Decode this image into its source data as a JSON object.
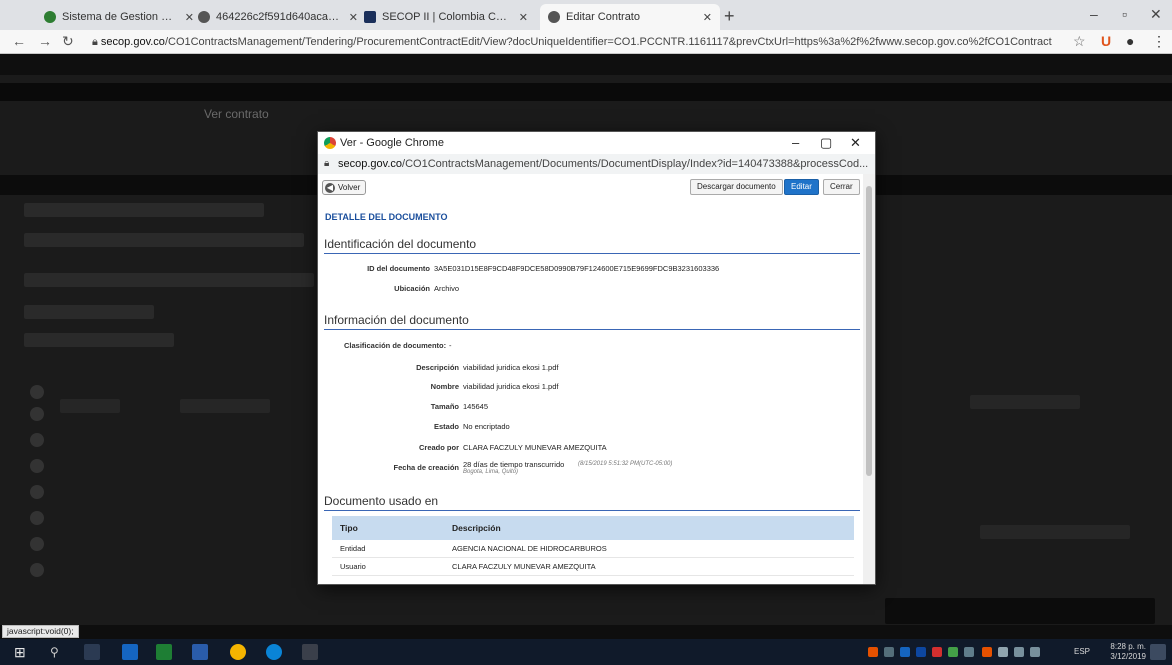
{
  "browser": {
    "tabs": [
      {
        "title": "Sistema de Gestion Documental",
        "color": "#2e7d32"
      },
      {
        "title": "464226c2f591d640aca9ab6de4...",
        "color": "#555555"
      },
      {
        "title": "SECOP II | Colombia Compra Efi...",
        "color": "#1a2f5a"
      },
      {
        "title": "Editar Contrato",
        "color": "#555555"
      }
    ],
    "url_host": "secop.gov.co",
    "url_path": "/CO1ContractsManagement/Tendering/ProcurementContractEdit/View?docUniqueIdentifier=CO1.PCCNTR.1161117&prevCtxUrl=https%3a%2f%2fwww.secop.gov.co%2fCO1ContractsManagement..."
  },
  "background": {
    "breadcrumb": "Ver contrato",
    "rows": [
      "Informacion general",
      "Condiciones",
      "Bienes y servicios",
      "Documentos del Proveedor",
      "Documentos del contrato",
      "Informacion presupuestal",
      "Ejecucion del contrato"
    ]
  },
  "popup": {
    "window_title": "Ver - Google Chrome",
    "url_host": "secop.gov.co",
    "url_path": "/CO1ContractsManagement/Documents/DocumentDisplay/Index?id=140473388&processCod...",
    "volver_label": "Volver",
    "descargar_label": "Descargar documento",
    "editar_label": "Editar",
    "cerrar_label": "Cerrar",
    "detail_title": "DETALLE DEL DOCUMENTO",
    "section1": "Identificación del documento",
    "id_label": "ID del documento",
    "id_value": "3A5E031D15E8F9CD48F9DCE58D0990B79F124600E715E9699FDC9B3231603336",
    "ubicacion_label": "Ubicación",
    "ubicacion_value": "Archivo",
    "section2": "Información del documento",
    "clasificacion_label": "Clasificación de documento:",
    "clasificacion_value": "-",
    "descripcion_label": "Descripción",
    "descripcion_value": "viabilidad juridica ekosi 1.pdf",
    "nombre_label": "Nombre",
    "nombre_value": "viabilidad juridica ekosi 1.pdf",
    "tamano_label": "Tamaño",
    "tamano_value": "145645",
    "estado_label": "Estado",
    "estado_value": "No encriptado",
    "creado_label": "Creado por",
    "creado_value": "CLARA FACZULY MUNEVAR AMEZQUITA",
    "fecha_label": "Fecha de creación",
    "fecha_value": "28 días de tiempo transcurrido",
    "fecha_detail": "(8/15/2019 5:51:32 PM(UTC-05:00)",
    "fecha_zone": "Bogota, Lima, Quito)",
    "section3": "Documento usado en",
    "table_headers": [
      "Tipo",
      "Descripción"
    ],
    "table_rows": [
      {
        "tipo": "Entidad",
        "descripcion": "AGENCIA NACIONAL DE HIDROCARBUROS"
      },
      {
        "tipo": "Usuario",
        "descripcion": "CLARA FACZULY MUNEVAR AMEZQUITA"
      }
    ]
  },
  "statusbar": "javascript:void(0);",
  "taskbar": {
    "lang": "ESP",
    "time": "8:28 p. m.",
    "date": "3/12/2019"
  }
}
